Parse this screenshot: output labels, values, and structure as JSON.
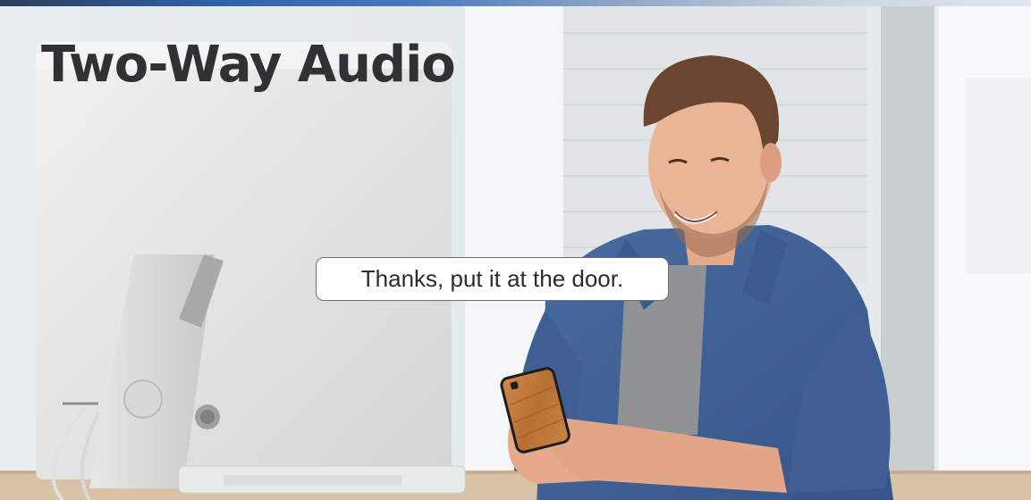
{
  "headline": {
    "text": "Two-Way Audio"
  },
  "speech_bubble": {
    "text": "Thanks, put it at the door."
  },
  "colors": {
    "headline_text": "#2f3134",
    "bubble_background": "#ffffff",
    "bubble_border": "#6f6f6f",
    "shirt": "#3f5f94",
    "phone_case": "#c07a3e"
  }
}
